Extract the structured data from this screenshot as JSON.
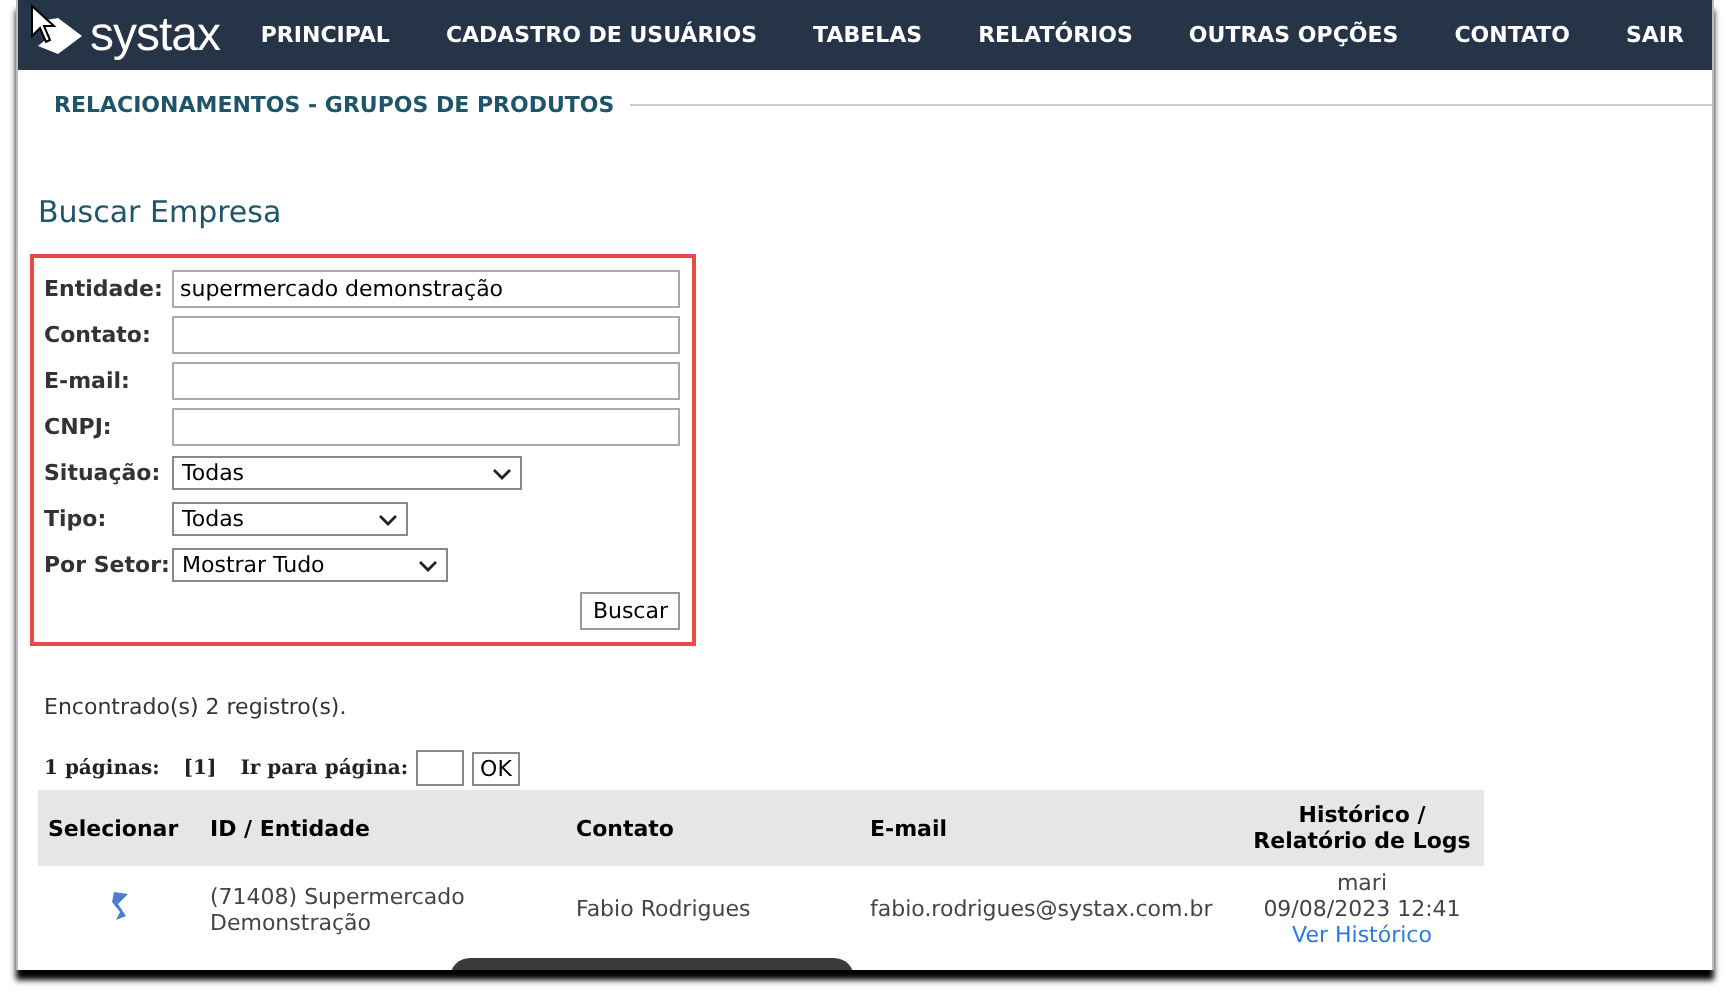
{
  "nav": {
    "logo": "systax",
    "items": [
      "PRINCIPAL",
      "CADASTRO DE USUÁRIOS",
      "TABELAS",
      "RELATÓRIOS",
      "OUTRAS OPÇÕES",
      "CONTATO",
      "SAIR"
    ]
  },
  "section_title": "RELACIONAMENTOS - GRUPOS DE PRODUTOS",
  "search": {
    "title": "Buscar Empresa",
    "fields": [
      {
        "kind": "text",
        "label": "Entidade:",
        "value": "supermercado demonstração"
      },
      {
        "kind": "text",
        "label": "Contato:"
      },
      {
        "kind": "text",
        "label": "E-mail:"
      },
      {
        "kind": "text",
        "label": "CNPJ:"
      },
      {
        "kind": "select",
        "label": "Situação:",
        "value": "Todas"
      },
      {
        "kind": "select",
        "label": "Tipo:",
        "value": "Todas"
      },
      {
        "kind": "select",
        "label": "Por Setor:",
        "value": "Mostrar Tudo"
      }
    ],
    "button": "Buscar"
  },
  "result_count": "Encontrado(s) 2 registro(s).",
  "pagination": {
    "pages_label": "1 páginas:",
    "current": "[1]",
    "goto_label": "Ir para página:",
    "button": "OK"
  },
  "table": {
    "columns": [
      "Selecionar",
      "ID / Entidade",
      "Contato",
      "E-mail",
      "Histórico / Relatório de Logs"
    ],
    "rows": [
      {
        "entity": "(71408) Supermercado Demonstração",
        "contact": "Fabio Rodrigues",
        "email": "fabio.rodrigues@systax.com.br",
        "history_user": "mari",
        "history_date": "09/08/2023 12:41",
        "history_link": "Ver Histórico"
      }
    ]
  }
}
